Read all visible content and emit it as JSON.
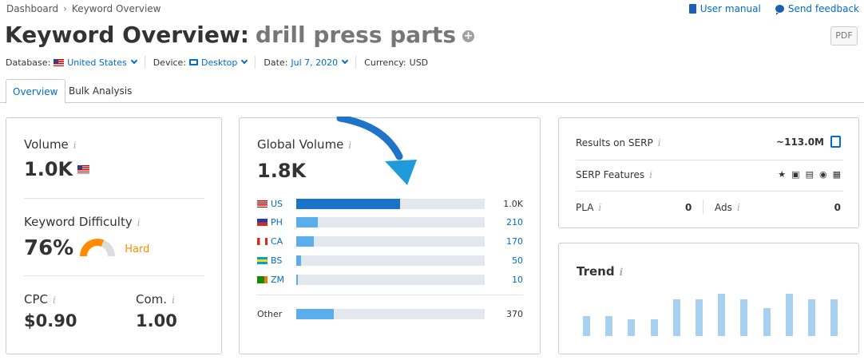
{
  "breadcrumb": {
    "root": "Dashboard",
    "current": "Keyword Overview"
  },
  "top_links": {
    "manual": "User manual",
    "feedback": "Send feedback"
  },
  "title": {
    "prefix": "Keyword Overview:",
    "keyword": "drill press parts"
  },
  "pdf_label": "PDF",
  "filters": {
    "database_label": "Database:",
    "database_value": "United States",
    "device_label": "Device:",
    "device_value": "Desktop",
    "date_label": "Date:",
    "date_value": "Jul 7, 2020",
    "currency_label": "Currency:",
    "currency_value": "USD"
  },
  "tabs": [
    {
      "label": "Overview",
      "active": true
    },
    {
      "label": "Bulk Analysis",
      "active": false
    }
  ],
  "volume": {
    "label": "Volume",
    "value": "1.0K"
  },
  "difficulty": {
    "label": "Keyword Difficulty",
    "value": "76%",
    "level": "Hard",
    "fraction": 0.76
  },
  "cpc": {
    "label": "CPC",
    "value": "$0.90"
  },
  "competition": {
    "label": "Com.",
    "value": "1.00"
  },
  "global": {
    "label": "Global Volume",
    "value": "1.8K",
    "rows": [
      {
        "code": "US",
        "value": "1.0K",
        "fraction": 0.55,
        "color": "#1a73c8",
        "flag": "us"
      },
      {
        "code": "PH",
        "value": "210",
        "fraction": 0.115,
        "color": "#5aaeee",
        "flag": "ph"
      },
      {
        "code": "CA",
        "value": "170",
        "fraction": 0.093,
        "color": "#5aaeee",
        "flag": "ca"
      },
      {
        "code": "BS",
        "value": "50",
        "fraction": 0.027,
        "color": "#5aaeee",
        "flag": "bs"
      },
      {
        "code": "ZM",
        "value": "10",
        "fraction": 0.006,
        "color": "#5aaeee",
        "flag": "zm"
      }
    ],
    "other": {
      "code": "Other",
      "value": "370",
      "fraction": 0.2,
      "color": "#5aaeee"
    }
  },
  "serp": {
    "results_label": "Results on SERP",
    "results_value": "~113.0M",
    "features_label": "SERP Features",
    "features_icons": [
      "star-icon",
      "video-icon",
      "image-icon",
      "play-icon",
      "calendar-icon"
    ],
    "pla_label": "PLA",
    "pla_value": "0",
    "ads_label": "Ads",
    "ads_value": "0"
  },
  "trend": {
    "label": "Trend",
    "values": [
      0.48,
      0.48,
      0.4,
      0.4,
      0.86,
      0.86,
      1.0,
      0.86,
      0.66,
      1.0,
      0.86,
      0.86
    ]
  },
  "colors": {
    "accent": "#006dca",
    "hard": "#ff8c00",
    "trend": "#a8d0f0",
    "arrow": "#1f73c8"
  }
}
